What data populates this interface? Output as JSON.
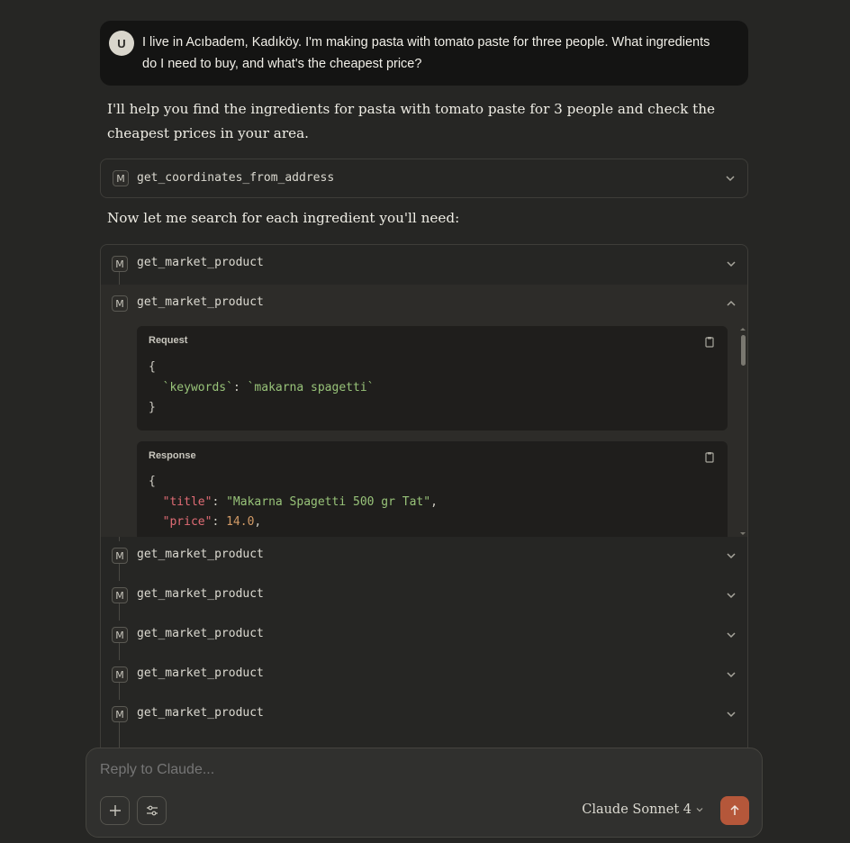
{
  "user_message": {
    "avatar_initial": "U",
    "text": "I live in Acıbadem, Kadıköy. I'm making pasta with tomato paste for three people. What ingredients do I need to buy, and what's the cheapest price?"
  },
  "assistant": {
    "intro": "I'll help you find the ingredients for pasta with tomato paste for 3 people and check the cheapest prices in your area.",
    "search_text": "Now let me search for each ingredient you'll need:"
  },
  "tools": {
    "badge": "M",
    "single_call": "get_coordinates_from_address",
    "group_calls": [
      "get_market_product",
      "get_market_product",
      "get_market_product",
      "get_market_product",
      "get_market_product",
      "get_market_product",
      "get_market_product"
    ],
    "request_label": "Request",
    "response_label": "Response",
    "request": {
      "key": "`keywords`",
      "value": "`makarna spagetti`"
    },
    "response": {
      "title_key": "\"title\"",
      "title_value": "\"Makarna Spagetti 500 gr Tat\"",
      "price_key": "\"price\"",
      "price_value": "14.0"
    }
  },
  "composer": {
    "placeholder": "Reply to Claude...",
    "model": "Claude Sonnet 4"
  },
  "colors": {
    "send_button": "#b5573a",
    "background": "#262624"
  }
}
